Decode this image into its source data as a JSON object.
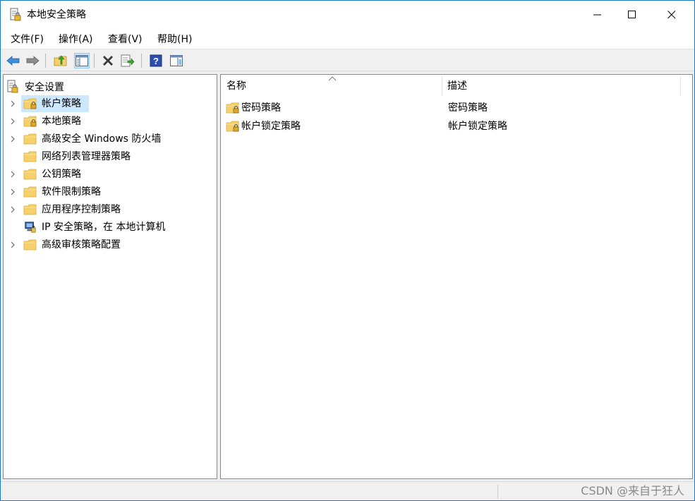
{
  "window": {
    "title": "本地安全策略",
    "controls": {
      "minimize": "minimize",
      "maximize": "maximize",
      "close": "close"
    }
  },
  "menu": [
    {
      "label": "文件(F)"
    },
    {
      "label": "操作(A)"
    },
    {
      "label": "查看(V)"
    },
    {
      "label": "帮助(H)"
    }
  ],
  "toolbar": {
    "buttons": [
      "back-arrow",
      "forward-arrow",
      "up-folder",
      "show-hide-tree",
      "delete",
      "export-list",
      "help",
      "show-hide-action-pane"
    ]
  },
  "tree": {
    "root": "安全设置",
    "items": [
      {
        "label": "帐户策略",
        "expandable": true,
        "selected": true,
        "icon": "folder-lock"
      },
      {
        "label": "本地策略",
        "expandable": true,
        "selected": false,
        "icon": "folder-lock"
      },
      {
        "label": "高级安全 Windows 防火墙",
        "expandable": true,
        "selected": false,
        "icon": "folder"
      },
      {
        "label": "网络列表管理器策略",
        "expandable": false,
        "selected": false,
        "icon": "folder"
      },
      {
        "label": "公钥策略",
        "expandable": true,
        "selected": false,
        "icon": "folder"
      },
      {
        "label": "软件限制策略",
        "expandable": true,
        "selected": false,
        "icon": "folder"
      },
      {
        "label": "应用程序控制策略",
        "expandable": true,
        "selected": false,
        "icon": "folder"
      },
      {
        "label": "IP 安全策略，在 本地计算机",
        "expandable": false,
        "selected": false,
        "icon": "ip-security"
      },
      {
        "label": "高级审核策略配置",
        "expandable": true,
        "selected": false,
        "icon": "folder"
      }
    ]
  },
  "list": {
    "columns": {
      "name": "名称",
      "description": "描述"
    },
    "rows": [
      {
        "name": "密码策略",
        "description": "密码策略"
      },
      {
        "name": "帐户锁定策略",
        "description": "帐户锁定策略"
      }
    ]
  },
  "statusbar": {
    "watermark": "CSDN @来自于狂人"
  },
  "colors": {
    "folder": "#f5d06b",
    "folder_edge": "#d9a93a",
    "selection": "#cce8ff",
    "accent": "#1e78c8"
  }
}
